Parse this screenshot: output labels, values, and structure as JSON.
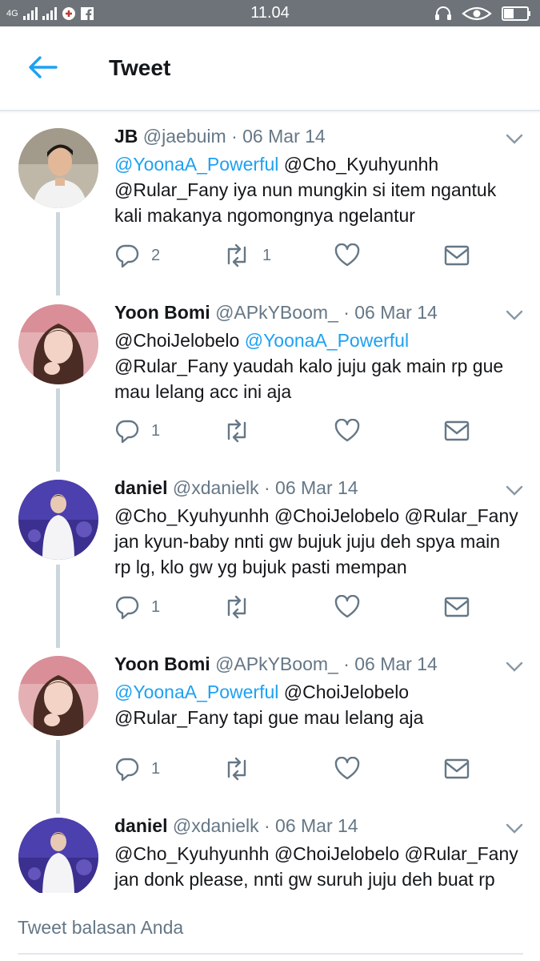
{
  "status_bar": {
    "network": "4G",
    "time": "11.04"
  },
  "header": {
    "title": "Tweet"
  },
  "tweets": [
    {
      "name": "JB",
      "handle": "@jaebuim",
      "date": "· 06 Mar 14",
      "line1": [
        {
          "text": "@YoonaA_Powerful",
          "mention": true
        },
        {
          "text": " @Cho_Kyuhyunhh",
          "mention": false
        }
      ],
      "line2": "@Rular_Fany iya nun mungkin si item ngantuk",
      "line3": "kali makanya ngomongnya ngelantur",
      "reply_count": "2",
      "retweet_count": "1"
    },
    {
      "name": "Yoon Bomi",
      "handle": "@APkYBoom_",
      "date": "· 06 Mar 14",
      "line1": [
        {
          "text": "@ChoiJelobelo ",
          "mention": false
        },
        {
          "text": "@YoonaA_Powerful",
          "mention": true
        }
      ],
      "line2": "@Rular_Fany yaudah kalo juju gak main rp gue",
      "line3": "mau lelang acc ini aja",
      "reply_count": "1",
      "retweet_count": ""
    },
    {
      "name": "daniel",
      "handle": "@xdanielk",
      "date": "· 06 Mar 14",
      "line1": [
        {
          "text": "@Cho_Kyuhyunhh @ChoiJelobelo @Rular_Fany",
          "mention": false
        }
      ],
      "line2": "jan kyun-baby nnti gw bujuk juju deh spya main",
      "line3": "rp lg, klo gw yg bujuk pasti mempan",
      "reply_count": "1",
      "retweet_count": ""
    },
    {
      "name": "Yoon Bomi",
      "handle": "@APkYBoom_",
      "date": "· 06 Mar 14",
      "line1": [
        {
          "text": "@YoonaA_Powerful",
          "mention": true
        },
        {
          "text": " @ChoiJelobelo",
          "mention": false
        }
      ],
      "line2": "@Rular_Fany tapi gue mau lelang aja",
      "line3": "",
      "reply_count": "1",
      "retweet_count": ""
    },
    {
      "name": "daniel",
      "handle": "@xdanielk",
      "date": "· 06 Mar 14",
      "line1": [
        {
          "text": "@Cho_Kyuhyunhh @ChoiJelobelo @Rular_Fany",
          "mention": false
        }
      ],
      "line2": "jan donk please, nnti gw suruh juju deh buat rp",
      "line3": "",
      "reply_count": "",
      "retweet_count": ""
    }
  ],
  "reply_box": {
    "placeholder": "Tweet balasan Anda"
  },
  "colors": {
    "accent": "#1da1f2",
    "secondary_text": "#657786",
    "status_bar": "#6d7378"
  }
}
